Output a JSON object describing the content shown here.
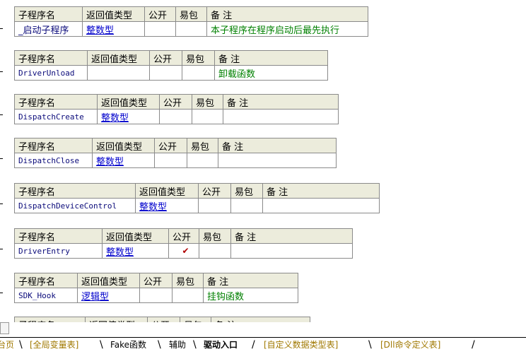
{
  "headers": {
    "name": "子程序名",
    "return_type": "返回值类型",
    "public": "公开",
    "easy_pack": "易包",
    "note": "备 注"
  },
  "subroutines": [
    {
      "name": "_启动子程序",
      "return_type": "整数型",
      "public": "",
      "note": "本子程序在程序启动后最先执行"
    },
    {
      "name": "DriverUnload",
      "return_type": "",
      "public": "",
      "note": "卸载函数"
    },
    {
      "name": "DispatchCreate",
      "return_type": "整数型",
      "public": "",
      "note": ""
    },
    {
      "name": "DispatchClose",
      "return_type": "整数型",
      "public": "",
      "note": ""
    },
    {
      "name": "DispatchDeviceControl",
      "return_type": "整数型",
      "public": "",
      "note": ""
    },
    {
      "name": "DriverEntry",
      "return_type": "整数型",
      "public": "✔",
      "note": ""
    },
    {
      "name": "SDK_Hook",
      "return_type": "逻辑型",
      "public": "",
      "note": "挂钩函数"
    }
  ],
  "tabs": [
    {
      "label": "台页",
      "active": false
    },
    {
      "label": "[全局变量表]",
      "active": false
    },
    {
      "label": "Fake函数",
      "active": false
    },
    {
      "label": "辅助",
      "active": false
    },
    {
      "label": "驱动入口",
      "active": true
    },
    {
      "label": "[自定义数据类型表]",
      "active": false
    },
    {
      "label": "[Dll命令定义表]",
      "active": false
    }
  ],
  "colors": {
    "header_bg": "#ececdc",
    "type_link": "#0000cc",
    "note_green": "#008000",
    "tab_inactive": "#a07800"
  }
}
